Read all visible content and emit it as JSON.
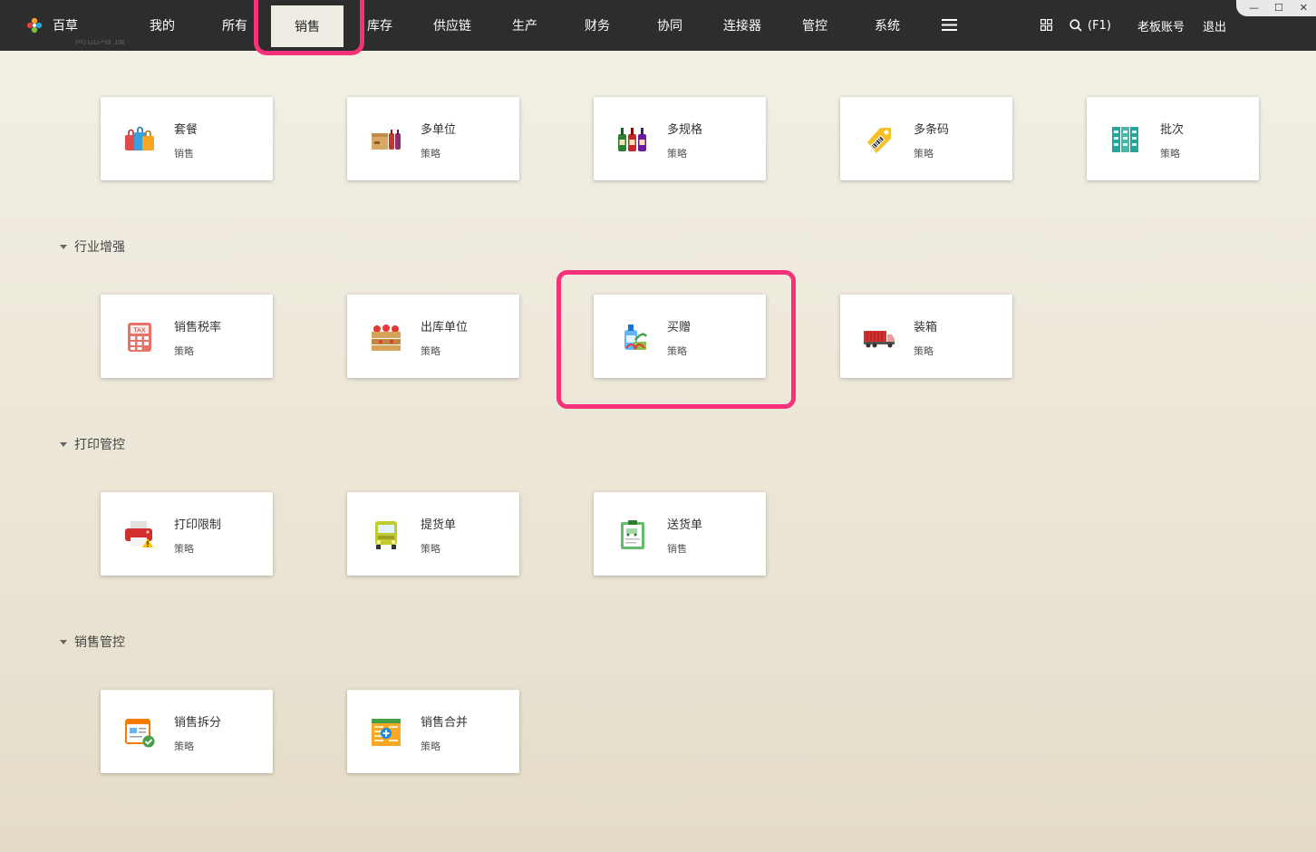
{
  "app": {
    "name": "百草"
  },
  "nav": {
    "items": [
      {
        "label": "我的"
      },
      {
        "label": "所有"
      },
      {
        "label": "销售",
        "active": true
      },
      {
        "label": "库存"
      },
      {
        "label": "供应链"
      },
      {
        "label": "生产"
      },
      {
        "label": "财务"
      },
      {
        "label": "协同"
      },
      {
        "label": "连接器"
      },
      {
        "label": "管控"
      },
      {
        "label": "系统"
      }
    ],
    "search_label": "(F1)",
    "account_label": "老板账号",
    "logout_label": "退出"
  },
  "window_controls": {
    "minimize": "—",
    "maximize": "☐",
    "close": "✕"
  },
  "sections": [
    {
      "title": "商品增强",
      "cards": [
        {
          "title": "套餐",
          "sub": "销售",
          "icon": "shopping-bags-icon"
        },
        {
          "title": "多单位",
          "sub": "策略",
          "icon": "box-bottles-icon"
        },
        {
          "title": "多规格",
          "sub": "策略",
          "icon": "wine-bottles-icon"
        },
        {
          "title": "多条码",
          "sub": "策略",
          "icon": "barcode-tag-icon"
        },
        {
          "title": "批次",
          "sub": "策略",
          "icon": "binders-icon"
        }
      ]
    },
    {
      "title": "行业增强",
      "cards": [
        {
          "title": "销售税率",
          "sub": "策略",
          "icon": "tax-calculator-icon"
        },
        {
          "title": "出库单位",
          "sub": "策略",
          "icon": "apple-crate-icon"
        },
        {
          "title": "买赠",
          "sub": "策略",
          "icon": "gift-bottle-icon"
        },
        {
          "title": "装箱",
          "sub": "策略",
          "icon": "container-truck-icon"
        }
      ]
    },
    {
      "title": "打印管控",
      "cards": [
        {
          "title": "打印限制",
          "sub": "策略",
          "icon": "printer-warning-icon"
        },
        {
          "title": "提货单",
          "sub": "策略",
          "icon": "truck-front-icon"
        },
        {
          "title": "送货单",
          "sub": "销售",
          "icon": "delivery-clipboard-icon"
        }
      ]
    },
    {
      "title": "销售管控",
      "cards": [
        {
          "title": "销售拆分",
          "sub": "策略",
          "icon": "document-check-icon"
        },
        {
          "title": "销售合并",
          "sub": "策略",
          "icon": "merge-sheet-icon"
        }
      ]
    }
  ],
  "colors": {
    "highlight": "#f5317a",
    "topbar": "#2d2d2d",
    "active_tab_bg": "#efece3"
  }
}
